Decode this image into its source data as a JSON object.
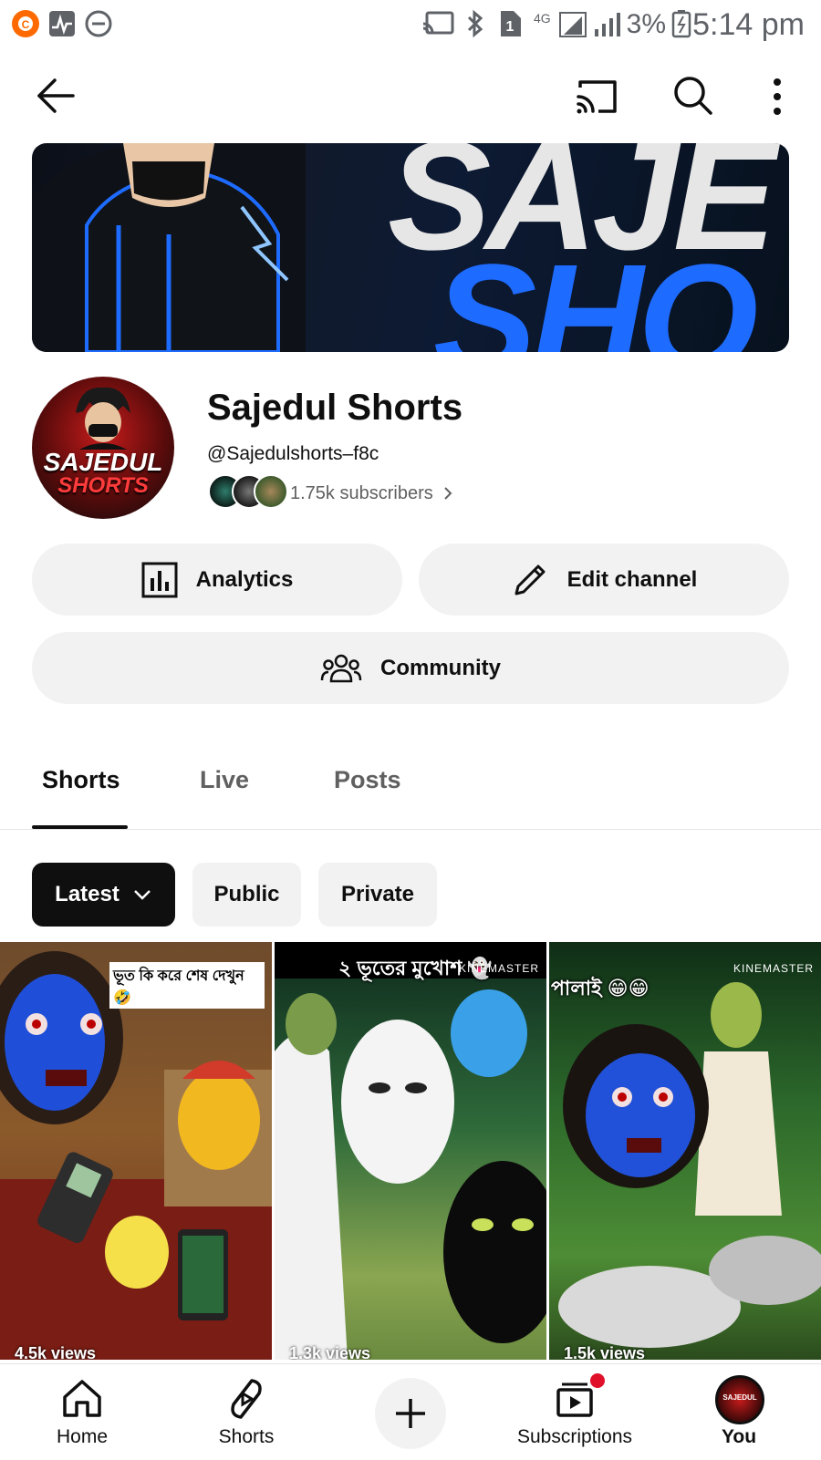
{
  "status_bar": {
    "time": "5:14 pm",
    "battery": "3%",
    "network": "4G",
    "sim_slot": "1",
    "icons": [
      "app-notification-icon",
      "activity-icon",
      "do-not-disturb-icon",
      "cast-icon",
      "bluetooth-icon",
      "sim-icon",
      "signal-icon",
      "battery-icon"
    ]
  },
  "top_bar": {
    "back_icon": "arrow-left-icon",
    "cast_icon": "cast-icon",
    "search_icon": "search-icon",
    "more_icon": "more-vertical-icon"
  },
  "channel": {
    "banner_text_top": "SAJE",
    "banner_text_bottom": "SHO",
    "avatar_line1": "SAJEDUL",
    "avatar_line2": "SHORTS",
    "name": "Sajedul Shorts",
    "handle": "@Sajedulshorts–f8c",
    "subscribers": "1.75k subscribers"
  },
  "actions": {
    "analytics_label": "Analytics",
    "edit_label": "Edit channel",
    "community_label": "Community"
  },
  "tabs": [
    {
      "label": "Shorts",
      "active": true
    },
    {
      "label": "Live",
      "active": false
    },
    {
      "label": "Posts",
      "active": false
    }
  ],
  "filters": {
    "sort_label": "Latest",
    "public_label": "Public",
    "private_label": "Private"
  },
  "shorts": [
    {
      "caption": "ভূত কি করে শেষ দেখুন 🤣",
      "views": "4.5k views",
      "watermark": ""
    },
    {
      "caption": "২ ভূতের মুখোশ 👻",
      "views": "1.3k views",
      "watermark": "KINEMASTER"
    },
    {
      "caption": "পালাই 😁😁",
      "views": "1.5k views",
      "watermark": "KINEMASTER"
    }
  ],
  "bottom_nav": {
    "home": "Home",
    "shorts": "Shorts",
    "subscriptions": "Subscriptions",
    "you": "You",
    "you_avatar_text": "SAJEDUL"
  },
  "colors": {
    "text": "#0f0f0f",
    "secondary_text": "#606060",
    "chip_bg": "#f2f2f2",
    "selected_chip_bg": "#0f0f0f",
    "notification": "#e0102b",
    "banner_blue": "#1e6bff"
  }
}
